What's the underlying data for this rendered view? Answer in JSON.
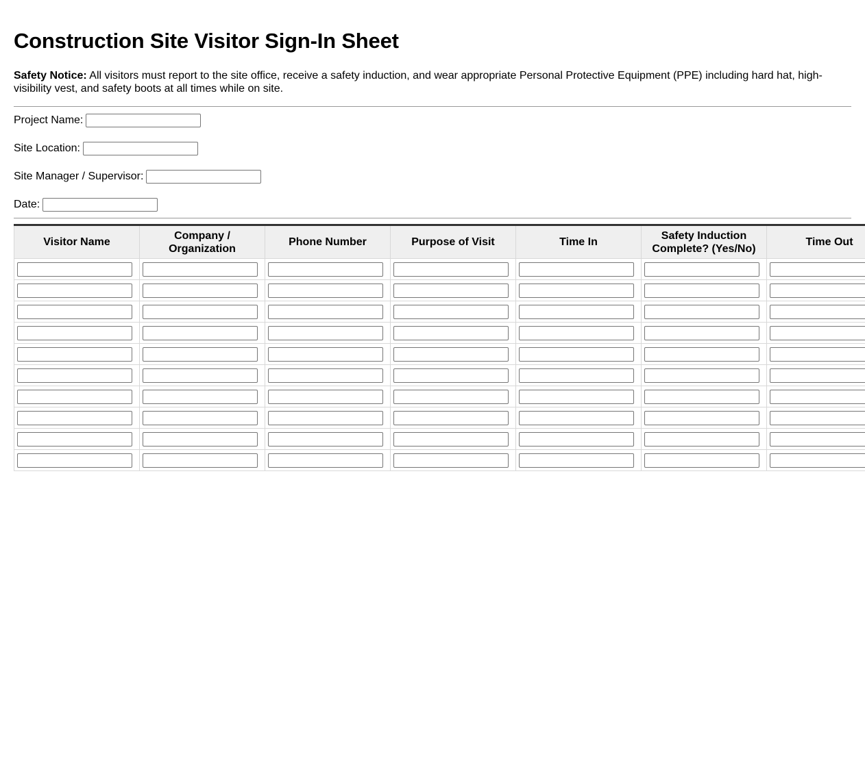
{
  "document": {
    "title": "Construction Site Visitor Sign-In Sheet",
    "notice_label": "Safety Notice:",
    "notice_text": " All visitors must report to the site office, receive a safety induction, and wear appropriate Personal Protective Equipment (PPE) including hard hat, high-visibility vest, and safety boots at all times while on site."
  },
  "fields": [
    {
      "label": "Project Name:",
      "value": ""
    },
    {
      "label": "Site Location:",
      "value": ""
    },
    {
      "label": "Site Manager / Supervisor:",
      "value": ""
    },
    {
      "label": "Date:",
      "value": ""
    }
  ],
  "table": {
    "columns": [
      "Visitor Name",
      "Company / Organization",
      "Phone Number",
      "Purpose of Visit",
      "Time In",
      "Safety Induction Complete? (Yes/No)",
      "Time Out",
      ""
    ],
    "rows": [
      [
        "",
        "",
        "",
        "",
        "",
        "",
        "",
        ""
      ],
      [
        "",
        "",
        "",
        "",
        "",
        "",
        "",
        ""
      ],
      [
        "",
        "",
        "",
        "",
        "",
        "",
        "",
        ""
      ],
      [
        "",
        "",
        "",
        "",
        "",
        "",
        "",
        ""
      ],
      [
        "",
        "",
        "",
        "",
        "",
        "",
        "",
        ""
      ],
      [
        "",
        "",
        "",
        "",
        "",
        "",
        "",
        ""
      ],
      [
        "",
        "",
        "",
        "",
        "",
        "",
        "",
        ""
      ],
      [
        "",
        "",
        "",
        "",
        "",
        "",
        "",
        ""
      ],
      [
        "",
        "",
        "",
        "",
        "",
        "",
        "",
        ""
      ],
      [
        "",
        "",
        "",
        "",
        "",
        "",
        "",
        ""
      ]
    ]
  }
}
